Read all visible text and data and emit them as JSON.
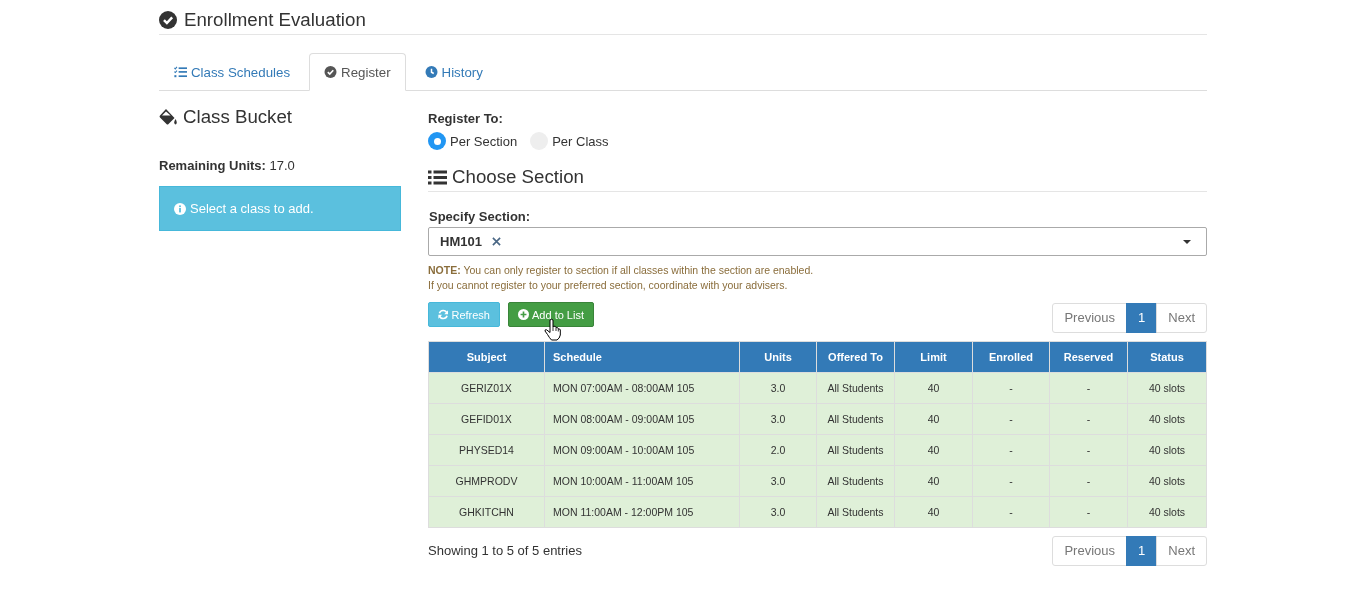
{
  "header": {
    "title": "Enrollment Evaluation"
  },
  "tabs": [
    {
      "label": "Class Schedules",
      "selected": false
    },
    {
      "label": "Register",
      "selected": true
    },
    {
      "label": "History",
      "selected": false
    }
  ],
  "bucket": {
    "title": "Class Bucket",
    "remaining_label": "Remaining Units:",
    "remaining_value": "17.0",
    "alert": "Select a class to add."
  },
  "register": {
    "label": "Register To:",
    "options": [
      {
        "label": "Per Section",
        "selected": true
      },
      {
        "label": "Per Class",
        "selected": false
      }
    ]
  },
  "choose_section": {
    "title": "Choose Section",
    "field_label": "Specify Section:",
    "selected_value": "HM101",
    "notes": [
      "**NOTE:** You can only register to section if all classes within the section are enabled.",
      "If you cannot register to your preferred section, coordinate with your advisers."
    ]
  },
  "buttons": [
    {
      "label": "Refresh",
      "kind": "refresh"
    },
    {
      "label": "Add to List",
      "kind": "add"
    }
  ],
  "pagination_top": {
    "previous": {
      "label": "Previous",
      "disabled": true
    },
    "pages": [
      {
        "label": "1",
        "selected": true
      }
    ],
    "next": {
      "label": "Next",
      "disabled": true
    }
  },
  "table": {
    "columns": [
      "Subject",
      "Schedule",
      "Units",
      "Offered To",
      "Limit",
      "Enrolled",
      "Reserved",
      "Status"
    ],
    "rows": [
      [
        "GERIZ01X",
        "MON 07:00AM - 08:00AM 105",
        "3.0",
        "All Students",
        "40",
        "-",
        "-",
        "40 slots"
      ],
      [
        "GEFID01X",
        "MON 08:00AM - 09:00AM 105",
        "3.0",
        "All Students",
        "40",
        "-",
        "-",
        "40 slots"
      ],
      [
        "PHYSED14",
        "MON 09:00AM - 10:00AM 105",
        "2.0",
        "All Students",
        "40",
        "-",
        "-",
        "40 slots"
      ],
      [
        "GHMPRODV",
        "MON 10:00AM - 11:00AM 105",
        "3.0",
        "All Students",
        "40",
        "-",
        "-",
        "40 slots"
      ],
      [
        "GHKITCHN",
        "MON 11:00AM - 12:00PM 105",
        "3.0",
        "All Students",
        "40",
        "-",
        "-",
        "40 slots"
      ]
    ]
  },
  "footer": {
    "info": "Showing 1 to 5 of 5 entries"
  },
  "pagination_bottom": {
    "previous": {
      "label": "Previous",
      "disabled": true
    },
    "pages": [
      {
        "label": "1",
        "selected": true
      }
    ],
    "next": {
      "label": "Next",
      "disabled": true
    }
  }
}
